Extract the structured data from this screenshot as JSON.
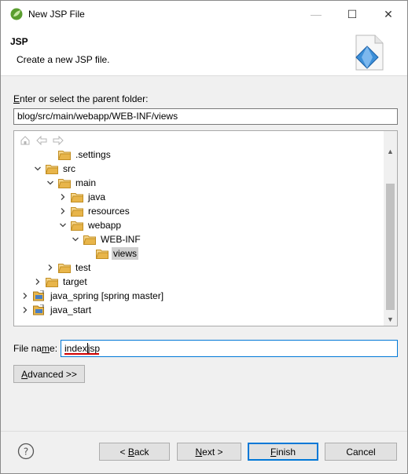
{
  "window": {
    "title": "New JSP File",
    "minimize_glyph": "—",
    "maximize_glyph": "☐",
    "close_glyph": "✕"
  },
  "banner": {
    "title": "JSP",
    "description": "Create a new JSP file."
  },
  "parent_folder": {
    "label_prefix": "E",
    "label_rest": "nter or select the parent folder:",
    "value": "blog/src/main/webapp/WEB-INF/views"
  },
  "tree": {
    "items": [
      {
        "label": ".settings",
        "twisty": "none",
        "icon": "folder-icon"
      },
      {
        "label": "src",
        "twisty": "expanded",
        "icon": "folder-icon"
      },
      {
        "label": "main",
        "twisty": "expanded",
        "icon": "folder-icon"
      },
      {
        "label": "java",
        "twisty": "collapsed",
        "icon": "folder-icon"
      },
      {
        "label": "resources",
        "twisty": "collapsed",
        "icon": "folder-icon"
      },
      {
        "label": "webapp",
        "twisty": "expanded",
        "icon": "folder-icon"
      },
      {
        "label": "WEB-INF",
        "twisty": "expanded",
        "icon": "folder-icon"
      },
      {
        "label": "views",
        "twisty": "none",
        "icon": "folder-icon",
        "selected": true
      },
      {
        "label": "test",
        "twisty": "collapsed",
        "icon": "folder-icon"
      },
      {
        "label": "target",
        "twisty": "collapsed",
        "icon": "folder-icon"
      },
      {
        "label": "java_spring [spring master]",
        "twisty": "collapsed",
        "icon": "project-icon"
      },
      {
        "label": "java_start",
        "twisty": "collapsed",
        "icon": "project-icon"
      }
    ]
  },
  "file_name": {
    "label_pre": "File na",
    "label_u": "m",
    "label_post": "e:",
    "value_before_caret": "index",
    "value_after_caret": "jsp"
  },
  "buttons": {
    "advanced_u": "A",
    "advanced_rest": "dvanced >>",
    "back_pre": "< ",
    "back_u": "B",
    "back_rest": "ack",
    "next_u": "N",
    "next_rest": "ext >",
    "finish_u": "F",
    "finish_rest": "inish",
    "cancel": "Cancel"
  },
  "colors": {
    "accent": "#0078d7",
    "folder": "#e8b54a",
    "selected_row": "#cfcfcf"
  }
}
